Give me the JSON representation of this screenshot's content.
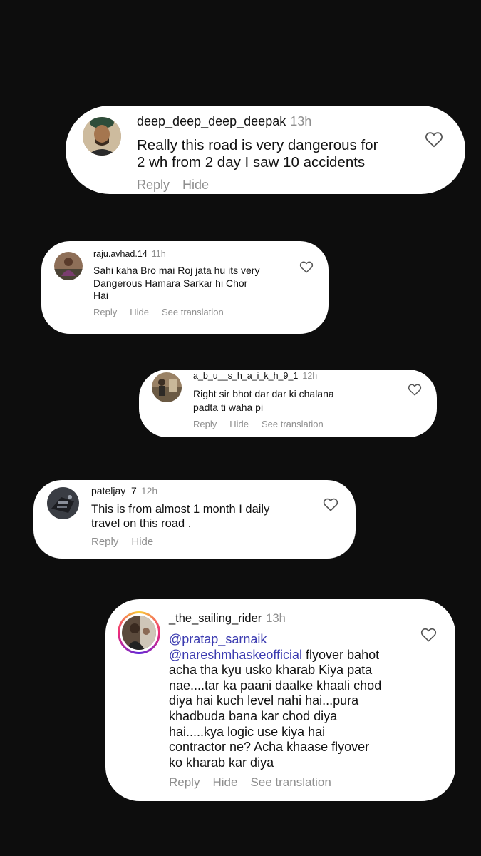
{
  "comments": [
    {
      "username": "deep_deep_deep_deepak",
      "time": "13h",
      "text": "Really this road is very dangerous for\n2 wh from 2 day I saw 10 accidents",
      "actions": [
        "Reply",
        "Hide"
      ]
    },
    {
      "username": "raju.avhad.14",
      "time": "11h",
      "text": "Sahi kaha Bro mai Roj jata hu its very\nDangerous Hamara Sarkar hi Chor\nHai",
      "actions": [
        "Reply",
        "Hide",
        "See translation"
      ]
    },
    {
      "username": "a_b_u__s_h_a_i_k_h_9_1",
      "time": "12h",
      "text": "Right sir  bhot dar dar ki chalana\npadta ti waha pi",
      "actions": [
        "Reply",
        "Hide",
        "See translation"
      ]
    },
    {
      "username": "pateljay_7",
      "time": "12h",
      "text": "This is from almost 1 month I daily\ntravel on this road .",
      "actions": [
        "Reply",
        "Hide"
      ]
    },
    {
      "username": "_the_sailing_rider",
      "time": "13h",
      "mention1": "@pratap_sarnaik",
      "mention2": "@nareshmhaskeofficial",
      "text_after_mention": " flyover bahot\nacha tha kyu usko kharab Kiya pata\nnae....tar ka paani daalke khaali chod\ndiya hai kuch level nahi hai...pura\nkhadbuda bana kar chod diya\nhai.....kya logic use kiya hai\ncontractor ne? Acha khaase flyover\nko kharab kar diya",
      "actions": [
        "Reply",
        "Hide",
        "See translation"
      ]
    }
  ],
  "icons": {
    "like": "heart-outline-icon"
  }
}
